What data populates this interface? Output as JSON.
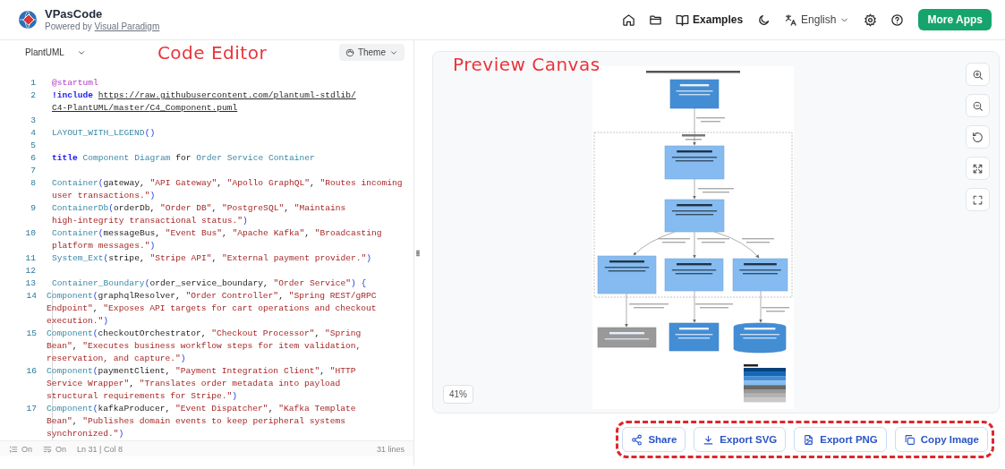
{
  "header": {
    "app_name": "VPasCode",
    "powered_by": "Powered by",
    "powered_link": "Visual Paradigm",
    "examples": "Examples",
    "language": "English",
    "more_apps": "More Apps"
  },
  "editor": {
    "language": "PlantUML",
    "theme": "Theme",
    "annotation": "Code Editor",
    "lines": [
      {
        "number": "1",
        "segments": [
          {
            "kind": "directive",
            "text": "@startuml"
          }
        ]
      },
      {
        "number": "2",
        "segments": [
          {
            "kind": "keyword",
            "text": "!include "
          },
          {
            "kind": "link",
            "text": "https://raw.githubusercontent.com/plantuml-stdlib/C4-PlantUML/master/C4_Component.puml"
          }
        ]
      },
      {
        "number": "3"
      },
      {
        "number": "4",
        "segments": [
          {
            "kind": "func",
            "text": "LAYOUT_WITH_LEGEND"
          },
          {
            "kind": "paren",
            "text": "()"
          }
        ]
      },
      {
        "number": "5"
      },
      {
        "number": "6",
        "segments": [
          {
            "kind": "keyword",
            "text": "title "
          },
          {
            "kind": "name",
            "text": "Component Diagram"
          },
          {
            "kind": "plain",
            "text": " for "
          },
          {
            "kind": "name",
            "text": "Order Service Container"
          }
        ]
      },
      {
        "number": "7"
      },
      {
        "number": "8",
        "segments": [
          {
            "kind": "func",
            "text": "Container"
          },
          {
            "kind": "paren",
            "text": "("
          },
          {
            "kind": "plain",
            "text": "gateway, "
          },
          {
            "kind": "string",
            "text": "\"API Gateway\""
          },
          {
            "kind": "plain",
            "text": ", "
          },
          {
            "kind": "string",
            "text": "\"Apollo GraphQL\""
          },
          {
            "kind": "plain",
            "text": ", "
          },
          {
            "kind": "string",
            "text": "\"Routes incoming user transactions.\""
          },
          {
            "kind": "paren",
            "text": ")"
          }
        ]
      },
      {
        "number": "9",
        "segments": [
          {
            "kind": "func",
            "text": "ContainerDb"
          },
          {
            "kind": "paren",
            "text": "("
          },
          {
            "kind": "plain",
            "text": "orderDb, "
          },
          {
            "kind": "string",
            "text": "\"Order DB\""
          },
          {
            "kind": "plain",
            "text": ", "
          },
          {
            "kind": "string",
            "text": "\"PostgreSQL\""
          },
          {
            "kind": "plain",
            "text": ", "
          },
          {
            "kind": "string",
            "text": "\"Maintains high-integrity transactional status.\""
          },
          {
            "kind": "paren",
            "text": ")"
          }
        ]
      },
      {
        "number": "10",
        "segments": [
          {
            "kind": "func",
            "text": "Container"
          },
          {
            "kind": "paren",
            "text": "("
          },
          {
            "kind": "plain",
            "text": "messageBus, "
          },
          {
            "kind": "string",
            "text": "\"Event Bus\""
          },
          {
            "kind": "plain",
            "text": ", "
          },
          {
            "kind": "string",
            "text": "\"Apache Kafka\""
          },
          {
            "kind": "plain",
            "text": ", "
          },
          {
            "kind": "string",
            "text": "\"Broadcasting platform messages.\""
          },
          {
            "kind": "paren",
            "text": ")"
          }
        ]
      },
      {
        "number": "11",
        "segments": [
          {
            "kind": "func",
            "text": "System_Ext"
          },
          {
            "kind": "paren",
            "text": "("
          },
          {
            "kind": "plain",
            "text": "stripe, "
          },
          {
            "kind": "string",
            "text": "\"Stripe API\""
          },
          {
            "kind": "plain",
            "text": ", "
          },
          {
            "kind": "string",
            "text": "\"External payment provider.\""
          },
          {
            "kind": "paren",
            "text": ")"
          }
        ]
      },
      {
        "number": "12"
      },
      {
        "number": "13",
        "segments": [
          {
            "kind": "func",
            "text": "Container_Boundary"
          },
          {
            "kind": "paren",
            "text": "("
          },
          {
            "kind": "plain",
            "text": "order_service_boundary, "
          },
          {
            "kind": "string",
            "text": "\"Order Service\""
          },
          {
            "kind": "paren",
            "text": ") {"
          }
        ],
        "children": [
          {
            "number": "14",
            "segments": [
              {
                "kind": "func",
                "text": "Component"
              },
              {
                "kind": "paren",
                "text": "("
              },
              {
                "kind": "plain",
                "text": "graphqlResolver, "
              },
              {
                "kind": "string",
                "text": "\"Order Controller\""
              },
              {
                "kind": "plain",
                "text": ", "
              },
              {
                "kind": "string",
                "text": "\"Spring REST/gRPC Endpoint\""
              },
              {
                "kind": "plain",
                "text": ", "
              },
              {
                "kind": "string",
                "text": "\"Exposes API targets for cart operations and checkout execution.\""
              },
              {
                "kind": "paren",
                "text": ")"
              }
            ]
          },
          {
            "number": "15",
            "segments": [
              {
                "kind": "func",
                "text": "Component"
              },
              {
                "kind": "paren",
                "text": "("
              },
              {
                "kind": "plain",
                "text": "checkoutOrchestrator, "
              },
              {
                "kind": "string",
                "text": "\"Checkout Processor\""
              },
              {
                "kind": "plain",
                "text": ", "
              },
              {
                "kind": "string",
                "text": "\"Spring Bean\""
              },
              {
                "kind": "plain",
                "text": ", "
              },
              {
                "kind": "string",
                "text": "\"Executes business workflow steps for item validation, reservation, and capture.\""
              },
              {
                "kind": "paren",
                "text": ")"
              }
            ]
          },
          {
            "number": "16",
            "segments": [
              {
                "kind": "func",
                "text": "Component"
              },
              {
                "kind": "paren",
                "text": "("
              },
              {
                "kind": "plain",
                "text": "paymentClient, "
              },
              {
                "kind": "string",
                "text": "\"Payment Integration Client\""
              },
              {
                "kind": "plain",
                "text": ", "
              },
              {
                "kind": "string",
                "text": "\"HTTP Service Wrapper\""
              },
              {
                "kind": "plain",
                "text": ", "
              },
              {
                "kind": "string",
                "text": "\"Translates order metadata into payload structural requirements for Stripe.\""
              },
              {
                "kind": "paren",
                "text": ")"
              }
            ]
          },
          {
            "number": "17",
            "segments": [
              {
                "kind": "func",
                "text": "Component"
              },
              {
                "kind": "paren",
                "text": "("
              },
              {
                "kind": "plain",
                "text": "kafkaProducer, "
              },
              {
                "kind": "string",
                "text": "\"Event Dispatcher\""
              },
              {
                "kind": "plain",
                "text": ", "
              },
              {
                "kind": "string",
                "text": "\"Kafka Template Bean\""
              },
              {
                "kind": "plain",
                "text": ", "
              },
              {
                "kind": "string",
                "text": "\"Publishes domain events to keep peripheral systems synchronized.\""
              },
              {
                "kind": "paren",
                "text": ")"
              }
            ]
          }
        ]
      }
    ],
    "status": {
      "line_numbers": "On",
      "word_wrap": "On",
      "position": "Ln 31 | Col 8",
      "line_count": "31 lines"
    }
  },
  "preview": {
    "annotation": "Preview Canvas",
    "zoom": "41%",
    "actions": [
      "Share",
      "Export SVG",
      "Export PNG",
      "Copy Image"
    ]
  }
}
